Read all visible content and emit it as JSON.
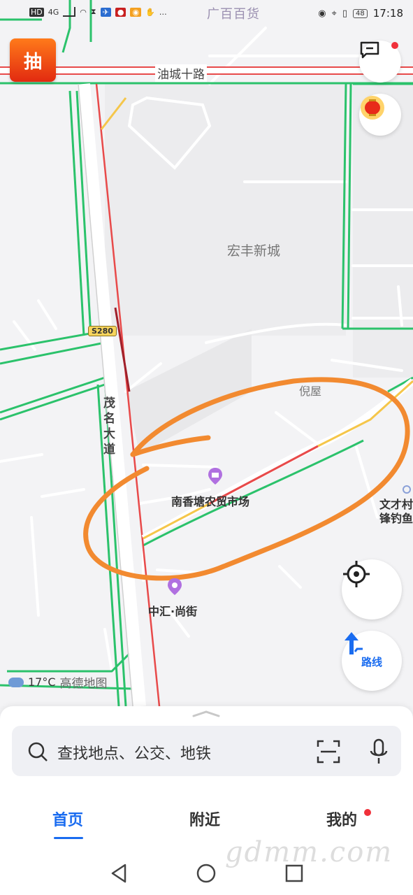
{
  "status_bar": {
    "left_icons": [
      "HD",
      "4G",
      "wifi-icon",
      "hourglass-icon",
      "app-icon",
      "mic-icon",
      "weibo-icon",
      "hand-icon",
      "…"
    ],
    "store_label": "广百百货",
    "battery": "48",
    "time": "17:18"
  },
  "map": {
    "lottery_label": "抽",
    "roads": {
      "top": "油城十路",
      "vertical": "茂名大道",
      "shield": "S280"
    },
    "areas": {
      "district": "宏丰新城",
      "village": "倪屋"
    },
    "pois": {
      "market": "南香塘农贸市场",
      "shopping": "中汇·尚街",
      "right_cut_1": "文才村",
      "right_cut_2": "锋钓鱼"
    },
    "weather": {
      "temperature": "17°C",
      "brand": "高德地图"
    },
    "route_label": "路线"
  },
  "search": {
    "placeholder": "查找地点、公交、地铁"
  },
  "tabs": [
    {
      "label": "首页",
      "active": true
    },
    {
      "label": "附近",
      "active": false
    },
    {
      "label": "我的",
      "active": false
    }
  ],
  "watermark": "gdmm.com",
  "colors": {
    "accent": "#1a6cf0",
    "road_green": "#2bc26b",
    "road_red": "#e84a4a",
    "road_yellow": "#f5c64a",
    "annotation_orange": "#f28a30",
    "poi_purple": "#b070e0"
  }
}
